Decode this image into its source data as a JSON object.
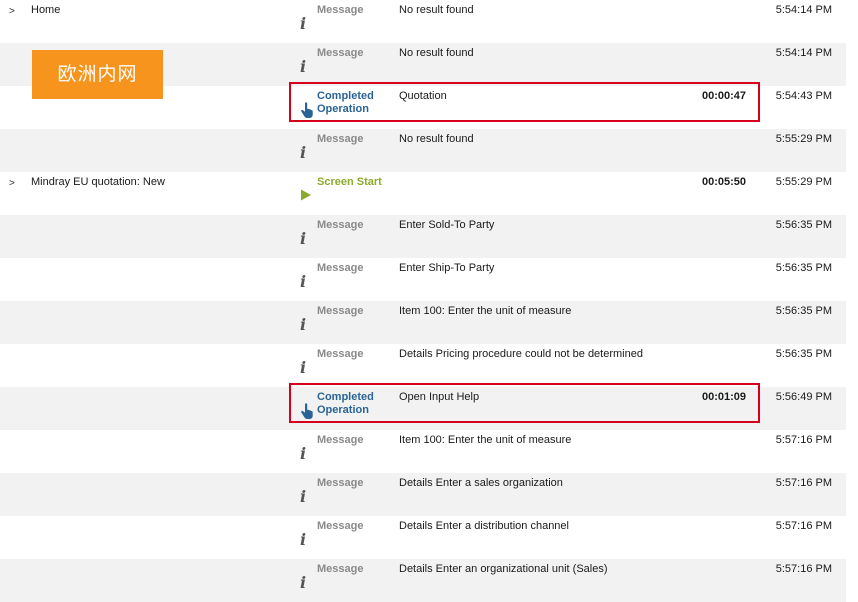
{
  "watermark": {
    "text": "欧洲内网"
  },
  "colors": {
    "message_type": "#8a8a8a",
    "operation_type": "#2a6496",
    "screen_type": "#8caa2b",
    "highlight_border": "#d6001c",
    "watermark_bg": "#f7941d"
  },
  "rows": [
    {
      "caret": ">",
      "screen": "Home",
      "icon": "info-icon",
      "type": "Message",
      "type_class": "message",
      "description": "No result found",
      "duration": "",
      "time": "5:54:14 PM",
      "highlighted": false
    },
    {
      "caret": "",
      "screen": "",
      "icon": "info-icon",
      "type": "Message",
      "type_class": "message",
      "description": "No result found",
      "duration": "",
      "time": "5:54:14 PM",
      "highlighted": false
    },
    {
      "caret": "",
      "screen": "",
      "icon": "pointing-hand-icon",
      "type": "Completed Operation",
      "type_class": "operation",
      "description": "Quotation",
      "duration": "00:00:47",
      "time": "5:54:43 PM",
      "highlighted": true
    },
    {
      "caret": "",
      "screen": "",
      "icon": "info-icon",
      "type": "Message",
      "type_class": "message",
      "description": "No result found",
      "duration": "",
      "time": "5:55:29 PM",
      "highlighted": false
    },
    {
      "caret": ">",
      "screen": "Mindray EU quotation: New",
      "icon": "play-icon",
      "type": "Screen Start",
      "type_class": "screen",
      "description": "",
      "duration": "00:05:50",
      "time": "5:55:29 PM",
      "highlighted": false
    },
    {
      "caret": "",
      "screen": "",
      "icon": "info-icon",
      "type": "Message",
      "type_class": "message",
      "description": "Enter Sold-To Party",
      "duration": "",
      "time": "5:56:35 PM",
      "highlighted": false
    },
    {
      "caret": "",
      "screen": "",
      "icon": "info-icon",
      "type": "Message",
      "type_class": "message",
      "description": "Enter Ship-To Party",
      "duration": "",
      "time": "5:56:35 PM",
      "highlighted": false
    },
    {
      "caret": "",
      "screen": "",
      "icon": "info-icon",
      "type": "Message",
      "type_class": "message",
      "description": "Item 100: Enter the unit of measure",
      "duration": "",
      "time": "5:56:35 PM",
      "highlighted": false
    },
    {
      "caret": "",
      "screen": "",
      "icon": "info-icon",
      "type": "Message",
      "type_class": "message",
      "description": "Details Pricing procedure could not be determined",
      "duration": "",
      "time": "5:56:35 PM",
      "highlighted": false
    },
    {
      "caret": "",
      "screen": "",
      "icon": "pointing-hand-icon",
      "type": "Completed Operation",
      "type_class": "operation",
      "description": "Open Input Help",
      "duration": "00:01:09",
      "time": "5:56:49 PM",
      "highlighted": true
    },
    {
      "caret": "",
      "screen": "",
      "icon": "info-icon",
      "type": "Message",
      "type_class": "message",
      "description": "Item 100: Enter the unit of measure",
      "duration": "",
      "time": "5:57:16 PM",
      "highlighted": false
    },
    {
      "caret": "",
      "screen": "",
      "icon": "info-icon",
      "type": "Message",
      "type_class": "message",
      "description": "Details Enter a sales organization",
      "duration": "",
      "time": "5:57:16 PM",
      "highlighted": false
    },
    {
      "caret": "",
      "screen": "",
      "icon": "info-icon",
      "type": "Message",
      "type_class": "message",
      "description": "Details Enter a distribution channel",
      "duration": "",
      "time": "5:57:16 PM",
      "highlighted": false
    },
    {
      "caret": "",
      "screen": "",
      "icon": "info-icon",
      "type": "Message",
      "type_class": "message",
      "description": "Details Enter an organizational unit (Sales)",
      "duration": "",
      "time": "5:57:16 PM",
      "highlighted": false
    }
  ]
}
